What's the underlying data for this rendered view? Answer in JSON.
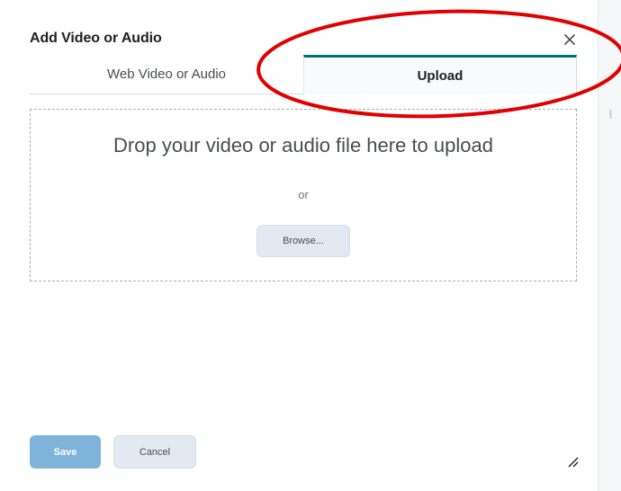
{
  "dialog": {
    "title": "Add Video or Audio",
    "close_icon": "close-icon",
    "tabs": [
      {
        "label": "Web Video or Audio",
        "selected": false
      },
      {
        "label": "Upload",
        "selected": true
      }
    ],
    "dropzone": {
      "text": "Drop your video or audio file here to upload",
      "or_text": "or",
      "browse_label": "Browse..."
    },
    "footer": {
      "save_label": "Save",
      "cancel_label": "Cancel",
      "save_disabled": true
    },
    "resize_icon": "resize-handle-icon"
  },
  "colors": {
    "accent_tab": "#006e7a",
    "annotation": "#e00000",
    "save_button": "#7fb3da",
    "secondary_button": "#e3e9f1"
  }
}
